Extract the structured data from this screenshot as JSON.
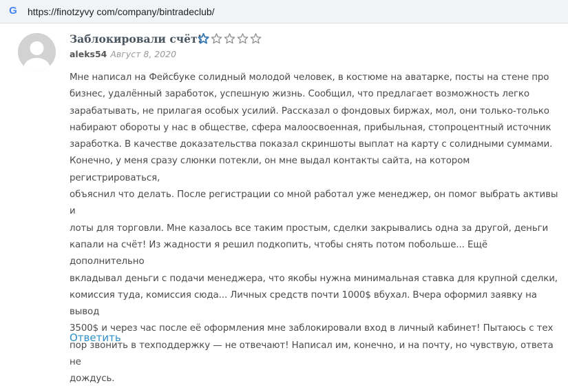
{
  "browser": {
    "url": "https://finotzyvy com/company/bintradeclub/",
    "favicon_letter": "G"
  },
  "review": {
    "title": "Заблокировали счёт!",
    "rating": 1,
    "rating_max": 5,
    "author": "aleks54",
    "date": "Август 8, 2020",
    "lines": [
      "Мне написал на Фейсбуке солидный молодой человек, в костюме на аватарке, посты на стене про",
      "бизнес, удалённый заработок, успешную жизнь. Сообщил, что предлагает возможность легко",
      "зарабатывать, не прилагая особых усилий. Рассказал о фондовых биржах, мол, они только-только",
      "набирают обороты у нас в обществе, сфера малоосвоенная, прибыльная, стопроцентный источник",
      "заработка. В качестве доказательства показал скриншоты выплат на карту с солидными суммами.",
      "Конечно, у меня сразу слюнки потекли, он мне выдал контакты сайта, на котором регистрироваться,",
      "объяснил что делать. После регистрации со мной работал уже менеджер, он помог выбрать активы и",
      "лоты для торговли. Мне казалось все таким простым, сделки закрывались одна за другой, деньги",
      "капали на счёт! Из жадности я решил подкопить, чтобы снять потом побольше... Ещё дополнительно",
      "вкладывал деньги с подачи менеджера, что якобы нужна минимальная ставка для крупной сделки,",
      "комиссия туда, комиссия сюда... Личных средств почти 1000$ вбухал. Вчера оформил заявку на вывод",
      "3500$ и через час после её оформления мне заблокировали вход в личный кабинет! Пытаюсь с тех",
      "пор звонить в техподдержку — не отвечают! Написал им, конечно, и на почту, но чувствую, ответа не",
      "дождусь."
    ],
    "reply_label": "Ответить"
  },
  "colors": {
    "star_filled": "#3a79b5",
    "star_empty": "#8a8a8a",
    "link": "#2e8fc7",
    "avatar_bg": "#d2d2d2"
  },
  "icons": {
    "favicon": "google-g-icon",
    "avatar": "user-silhouette-icon",
    "rating_star": "star-icon"
  }
}
